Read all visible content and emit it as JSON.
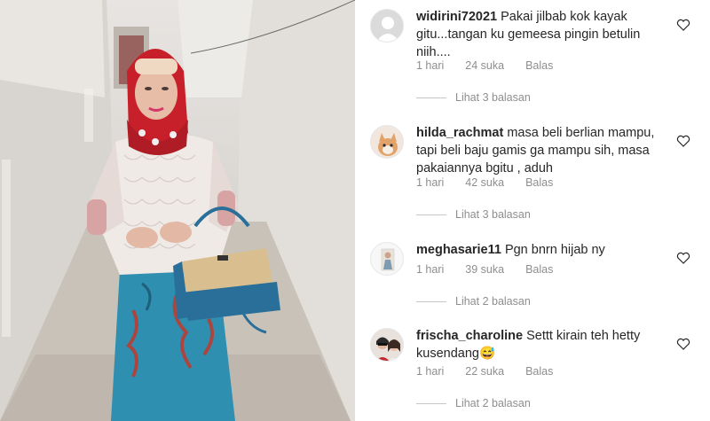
{
  "comments": [
    {
      "username": "widirini72021",
      "text": "Pakai jilbab kok kayak gitu...tangan ku gemeesa pingin betulin niih....",
      "time": "1 hari",
      "likes": "24 suka",
      "reply": "Balas",
      "view_replies": "Lihat 3 balasan",
      "avatar": "default-user-icon"
    },
    {
      "username": "hilda_rachmat",
      "text": "masa beli berlian mampu, tapi beli baju gamis ga mampu sih, masa pakaiannya bgitu , aduh",
      "time": "1 hari",
      "likes": "42 suka",
      "reply": "Balas",
      "view_replies": "Lihat 3 balasan",
      "avatar": "kitten-avatar"
    },
    {
      "username": "meghasarie11",
      "text": "Pgn bnrn hijab ny",
      "time": "1 hari",
      "likes": "39 suka",
      "reply": "Balas",
      "view_replies": "Lihat 2 balasan",
      "avatar": "person-photo-avatar"
    },
    {
      "username": "frischa_charoline",
      "text": "Settt kirain teh hetty kusendang😅",
      "time": "1 hari",
      "likes": "22 suka",
      "reply": "Balas",
      "view_replies": "Lihat 2 balasan",
      "avatar": "couple-photo-avatar"
    }
  ],
  "colors": {
    "text": "#262626",
    "muted": "#8e8e8e",
    "scarf": "#c8202a",
    "skirt": "#2f8fb0",
    "bag": "#2a6f9a"
  }
}
